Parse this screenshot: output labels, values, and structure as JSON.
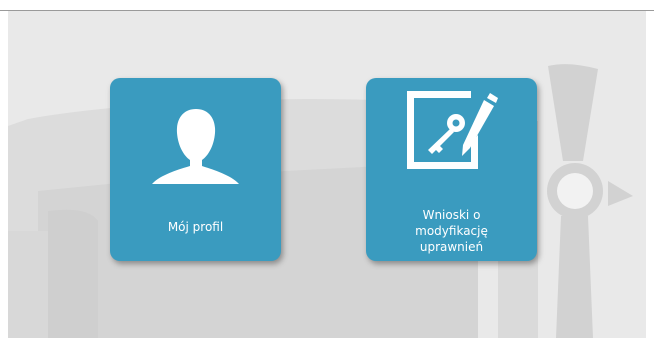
{
  "tiles": [
    {
      "label": "Mój profil",
      "icon": "user-icon"
    },
    {
      "label": "Wnioski o\nmodyfikację\nuprawnień",
      "icon": "key-pen-document-icon"
    }
  ],
  "colors": {
    "tile_background": "#3a9bbf",
    "tile_text": "#ffffff",
    "page_background": "#e9e9e9",
    "background_art": "#d3d3d3"
  }
}
